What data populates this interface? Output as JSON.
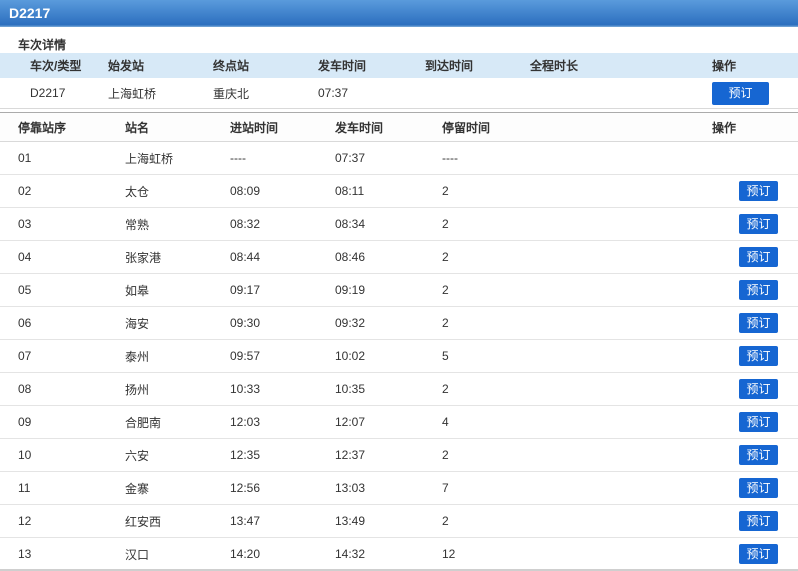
{
  "colors": {
    "titlebar_gradient_top": "#5a9bdc",
    "titlebar_gradient_bottom": "#2c6fbf",
    "table_header_bg": "#d7e9f7",
    "button_bg": "#1666d2",
    "button_text": "#ffffff",
    "body_text": "#333333"
  },
  "header": {
    "train_code": "D2217"
  },
  "section": {
    "title": "车次详情"
  },
  "summary": {
    "headers": [
      "车次/类型",
      "始发站",
      "终点站",
      "发车时间",
      "到达时间",
      "全程时长",
      "操作"
    ],
    "row": {
      "train": "D2217",
      "origin": "上海虹桥",
      "terminus": "重庆北",
      "depart": "07:37",
      "arrive": "",
      "duration": "",
      "action": "预订"
    }
  },
  "stops": {
    "headers": [
      "停靠站序",
      "站名",
      "进站时间",
      "发车时间",
      "停留时间",
      "操作"
    ],
    "rows": [
      {
        "seq": "01",
        "station": "上海虹桥",
        "arrive": "----",
        "depart": "07:37",
        "stay": "----",
        "action": ""
      },
      {
        "seq": "02",
        "station": "太仓",
        "arrive": "08:09",
        "depart": "08:11",
        "stay": "2",
        "action": "预订"
      },
      {
        "seq": "03",
        "station": "常熟",
        "arrive": "08:32",
        "depart": "08:34",
        "stay": "2",
        "action": "预订"
      },
      {
        "seq": "04",
        "station": "张家港",
        "arrive": "08:44",
        "depart": "08:46",
        "stay": "2",
        "action": "预订"
      },
      {
        "seq": "05",
        "station": "如皋",
        "arrive": "09:17",
        "depart": "09:19",
        "stay": "2",
        "action": "预订"
      },
      {
        "seq": "06",
        "station": "海安",
        "arrive": "09:30",
        "depart": "09:32",
        "stay": "2",
        "action": "预订"
      },
      {
        "seq": "07",
        "station": "泰州",
        "arrive": "09:57",
        "depart": "10:02",
        "stay": "5",
        "action": "预订"
      },
      {
        "seq": "08",
        "station": "扬州",
        "arrive": "10:33",
        "depart": "10:35",
        "stay": "2",
        "action": "预订"
      },
      {
        "seq": "09",
        "station": "合肥南",
        "arrive": "12:03",
        "depart": "12:07",
        "stay": "4",
        "action": "预订"
      },
      {
        "seq": "10",
        "station": "六安",
        "arrive": "12:35",
        "depart": "12:37",
        "stay": "2",
        "action": "预订"
      },
      {
        "seq": "11",
        "station": "金寨",
        "arrive": "12:56",
        "depart": "13:03",
        "stay": "7",
        "action": "预订"
      },
      {
        "seq": "12",
        "station": "红安西",
        "arrive": "13:47",
        "depart": "13:49",
        "stay": "2",
        "action": "预订"
      },
      {
        "seq": "13",
        "station": "汉口",
        "arrive": "14:20",
        "depart": "14:32",
        "stay": "12",
        "action": "预订"
      }
    ]
  }
}
